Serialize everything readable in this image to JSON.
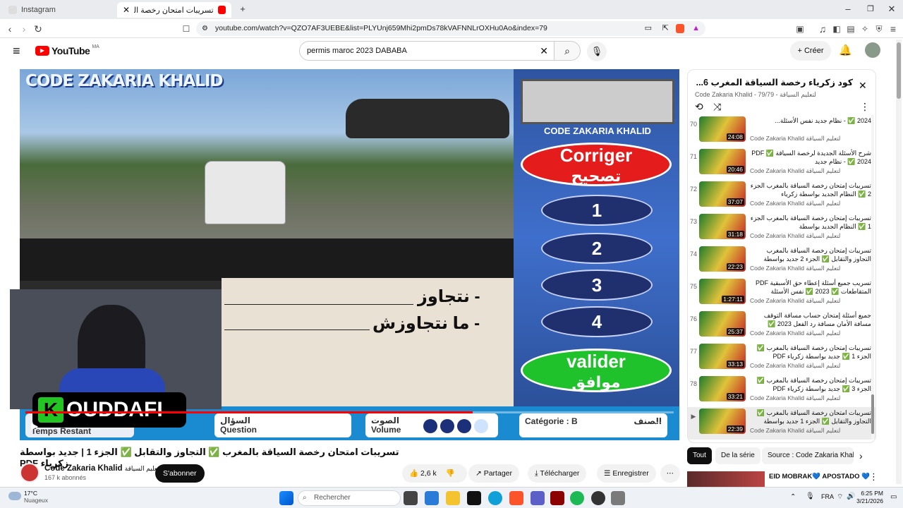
{
  "browser": {
    "tabs": [
      {
        "label": "Instagram",
        "active": false
      },
      {
        "label": "تسريبات امتحان رخصة السياقة بالمغ",
        "active": true
      }
    ],
    "url": "youtube.com/watch?v=QZO7AF3UEBE&list=PLYUnj659Mhi2pmDs78kVAFNNLrOXHu0Ao&index=79"
  },
  "youtube": {
    "logo": "YouTube",
    "region": "MA",
    "search_value": "permis maroc 2023 DABABA",
    "create_label": "Créer"
  },
  "video": {
    "brand": "CODE ZAKARIA KHALID",
    "panel_brand": "CODE ZAKARIA KHALID",
    "corriger": "Corriger",
    "corriger_ar": "تصحيح",
    "options": [
      "1",
      "2",
      "3",
      "4"
    ],
    "valider": "valider",
    "valider_ar": "موافق",
    "answer1": "- نتجاوز",
    "answer2": "- ما نتجاوزش",
    "streamer": "OUDDAFI",
    "streamer_initial": "K",
    "bottom": {
      "temps": "Temps Restant",
      "question_ar": "السؤال",
      "question": "Question",
      "volume_ar": "الصوت",
      "volume": "Volume",
      "categorie": "Catégorie : B",
      "categorie_ar": "الصنف"
    },
    "progress_fraction": 0.69
  },
  "below": {
    "title": "تسريبات امتحان رخصة السياقة بالمغرب ✅ التجاوز والتقابل ✅ الجزء 1 | جديد بواسطة زكرياء PDF",
    "channel": "Code Zakaria Khalid",
    "channel_ar": "لتعليم السياقة",
    "subscribers": "167 k abonnés",
    "subscribe": "S'abonner",
    "likes": "2,6 k",
    "share": "Partager",
    "download": "Télécharger",
    "save": "Enregistrer"
  },
  "playlist": {
    "title": "كود زكرياء رخصة السياقة المغرب 6...",
    "subtitle": "Code Zakaria Khalid - لتعليم السياقة - 79/79",
    "items": [
      {
        "num": "70",
        "title": "2024 ✅ - نظام جديد نفس الأسئلة...",
        "channel": "Code Zakaria Khalid",
        "channel_ar": "لتعليم السياقة",
        "duration": "24:08"
      },
      {
        "num": "71",
        "title": "شرح الأسئلة الجديدة لرخصة السياقة PDF ✅ 2024 ✅ - نظام جديد",
        "channel": "Code Zakaria Khalid",
        "channel_ar": "لتعليم السياقة",
        "duration": "20:46"
      },
      {
        "num": "72",
        "title": "تسريبات إمتحان رخصة السياقة بالمغرب الجزء 2 ✅ النظام الجديد بواسطة زكرياء",
        "channel": "Code Zakaria Khalid",
        "channel_ar": "لتعليم السياقة",
        "duration": "37:07"
      },
      {
        "num": "73",
        "title": "تسريبات إمتحان رخصة السياقة بالمغرب الجزء 1 ✅ النظام الجديد بواسطة",
        "channel": "Code Zakaria Khalid",
        "channel_ar": "لتعليم السياقة",
        "duration": "31:18"
      },
      {
        "num": "74",
        "title": "تسريبات إمتحان رخصة السياقة بالمغرب التجاوز والتقابل ✅ الجزء 2 جديد بواسطة",
        "channel": "Code Zakaria Khalid",
        "channel_ar": "لتعليم السياقة",
        "duration": "22:23"
      },
      {
        "num": "75",
        "title": "تسريب جميع أسئلة إعطاء حق الأسبقية PDF المتقاطعات ✅ 2023 ✅ نفس الأسئلة",
        "channel": "Code Zakaria Khalid",
        "channel_ar": "لتعليم السياقة",
        "duration": "1:27:11"
      },
      {
        "num": "76",
        "title": "جميع أسئلة إمتحان حساب مسافة التوقف مسافة الأمان مسافة رد الفعل 2023 ✅",
        "channel": "Code Zakaria Khalid",
        "channel_ar": "لتعليم السياقة",
        "duration": "25:37"
      },
      {
        "num": "77",
        "title": "تسريبات إمتحان رخصة السياقة بالمغرب ✅ الجزء 1 ✅ جديد بواسطة زكرياء PDF",
        "channel": "Code Zakaria Khalid",
        "channel_ar": "لتعليم السياقة",
        "duration": "33:13"
      },
      {
        "num": "78",
        "title": "تسريبات إمتحان رخصة السياقة بالمغرب ✅ الجزء 3 ✅ جديد بواسطة زكرياء PDF",
        "channel": "Code Zakaria Khalid",
        "channel_ar": "لتعليم السياقة",
        "duration": "33:21"
      },
      {
        "num": "▶",
        "title": "تسريبات امتحان رخصة السياقة بالمغرب ✅ التجاوز والتقابل ✅ الجزء 1 جديد بواسطة",
        "channel": "Code Zakaria Khalid",
        "channel_ar": "لتعليم السياقة",
        "duration": "22:39"
      }
    ],
    "chips": [
      "Tout",
      "De la série",
      "Source : Code Zakaria Khali"
    ],
    "next_video": "EID MOBRAK💙 APOSTADO 💙"
  },
  "taskbar": {
    "weather_temp": "17°C",
    "weather_desc": "Nuageux",
    "search_placeholder": "Rechercher",
    "lang": "FRA",
    "time": "6:25 PM",
    "date": "3/21/2026"
  }
}
